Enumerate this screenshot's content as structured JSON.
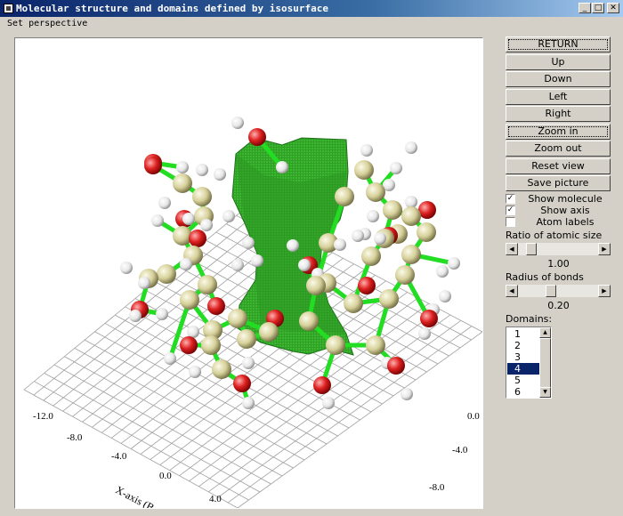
{
  "window": {
    "title": "Molecular structure and domains defined by isosurface",
    "controls": {
      "minimize": "_",
      "maximize": "□",
      "close": "✕"
    }
  },
  "menu": {
    "items": [
      "Set perspective"
    ]
  },
  "buttons": {
    "return": "RETURN",
    "up": "Up",
    "down": "Down",
    "left": "Left",
    "right": "Right",
    "zoom_in": "Zoom in",
    "zoom_out": "Zoom out",
    "reset_view": "Reset view",
    "save_picture": "Save picture"
  },
  "checkboxes": {
    "show_molecule": {
      "label": "Show molecule",
      "checked": true
    },
    "show_axis": {
      "label": "Show axis",
      "checked": true
    },
    "atom_labels": {
      "label": "Atom labels",
      "checked": false
    }
  },
  "sliders": {
    "atomic_size": {
      "label": "Ratio of atomic size",
      "value": "1.00",
      "position": 0.12
    },
    "bond_radius": {
      "label": "Radius of bonds",
      "value": "0.20",
      "position": 0.4
    }
  },
  "domains": {
    "label": "Domains:",
    "items": [
      "1",
      "2",
      "3",
      "4",
      "5",
      "6"
    ],
    "selected_index": 3
  },
  "plot": {
    "x_axis_label": "X-axis (Bo",
    "x_ticks": [
      "-12.0",
      "-8.0",
      "-4.0",
      "0.0",
      "4.0"
    ],
    "y_ticks": [
      "0.0",
      "-4.0",
      "-8.0"
    ],
    "colors": {
      "bond": "#22dd22",
      "carbon": "#d8d4a0",
      "oxygen": "#e02020",
      "hydrogen": "#ffffff",
      "isosurface": "#2a9a20",
      "grid": "#a0a0a0"
    }
  }
}
